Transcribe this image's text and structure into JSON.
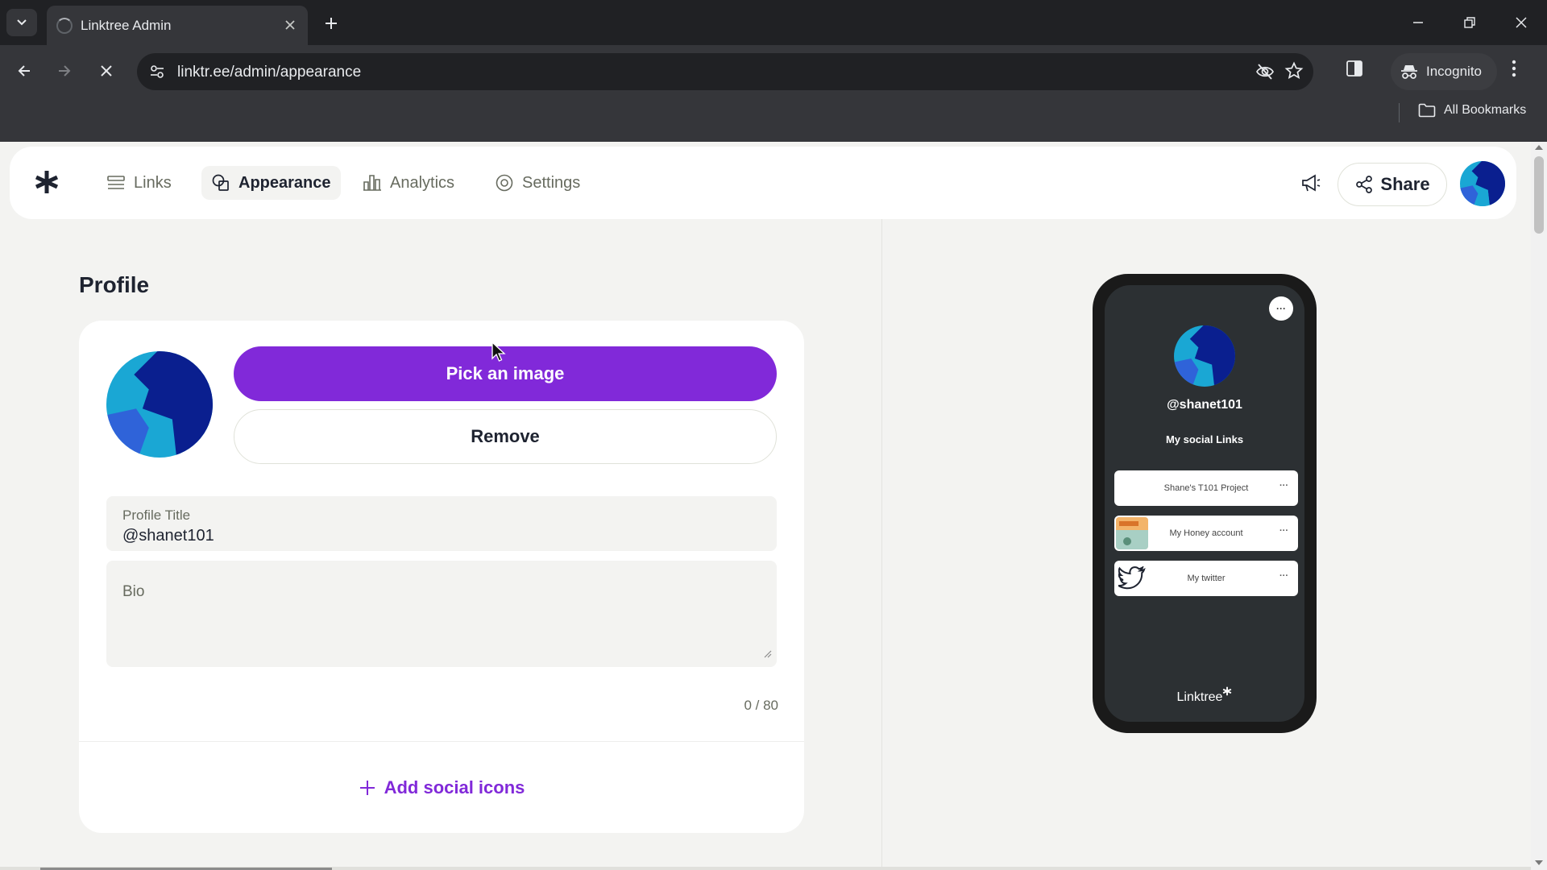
{
  "browser": {
    "tab_title": "Linktree Admin",
    "url": "linktr.ee/admin/appearance",
    "incognito_label": "Incognito",
    "bookmarks_label": "All Bookmarks"
  },
  "topnav": {
    "items": [
      {
        "label": "Links",
        "icon": "list-icon"
      },
      {
        "label": "Appearance",
        "icon": "shapes-icon",
        "active": true
      },
      {
        "label": "Analytics",
        "icon": "bar-chart-icon"
      },
      {
        "label": "Settings",
        "icon": "gear-icon"
      }
    ],
    "share_label": "Share"
  },
  "profile": {
    "heading": "Profile",
    "pick_image_label": "Pick an image",
    "remove_label": "Remove",
    "title_field_label": "Profile Title",
    "title_value": "@shanet101",
    "bio_placeholder": "Bio",
    "bio_counter": "0 / 80",
    "add_social_label": "Add social icons"
  },
  "preview": {
    "handle": "@shanet101",
    "bio": "My social Links",
    "links": [
      {
        "label": "Shane's T101 Project",
        "thumb": "none"
      },
      {
        "label": "My Honey account",
        "thumb": "honey-thumbnail"
      },
      {
        "label": "My twitter",
        "thumb": "twitter-bird-icon"
      }
    ],
    "link_menu_glyph": "···",
    "footer": "Linktree"
  },
  "colors": {
    "accent_purple": "#8129d9",
    "page_bg": "#f3f3f1",
    "phone_screen": "#2c3033"
  }
}
